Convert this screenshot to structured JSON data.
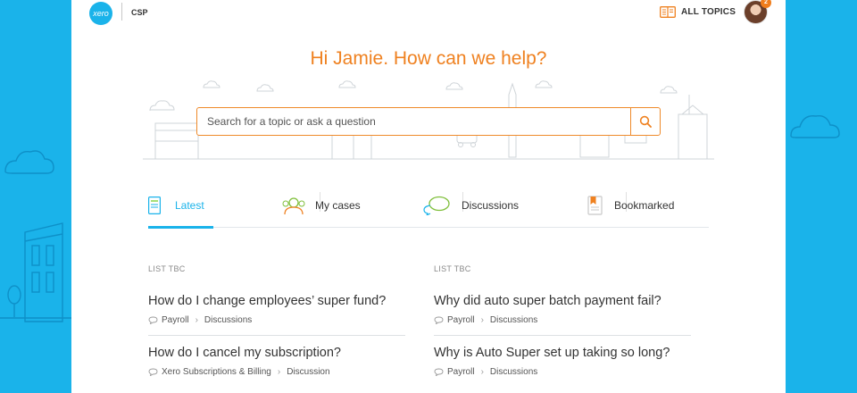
{
  "header": {
    "logo_text": "xero",
    "org_name": "CSP",
    "all_topics_label": "ALL TOPICS",
    "notification_count": "2"
  },
  "greeting": "Hi Jamie. How can we help?",
  "search": {
    "placeholder": "Search for a topic or ask a question"
  },
  "tabs": [
    {
      "label": "Latest",
      "icon": "latest-icon",
      "active": true
    },
    {
      "label": "My cases",
      "icon": "my-cases-icon",
      "active": false
    },
    {
      "label": "Discussions",
      "icon": "discussions-icon",
      "active": false
    },
    {
      "label": "Bookmarked",
      "icon": "bookmark-icon",
      "active": false
    }
  ],
  "lists": [
    {
      "heading": "LIST TBC",
      "items": [
        {
          "question": "How do I change employees’ super fund?",
          "category": "Payroll",
          "section": "Discussions"
        },
        {
          "question": "How do I cancel my subscription?",
          "category": "Xero Subscriptions & Billing",
          "section": "Discussion"
        }
      ]
    },
    {
      "heading": "LIST TBC",
      "items": [
        {
          "question": "Why did auto super batch payment fail?",
          "category": "Payroll",
          "section": "Discussions"
        },
        {
          "question": "Why is Auto Super set up taking so long?",
          "category": "Payroll",
          "section": "Discussions"
        }
      ]
    }
  ],
  "colors": {
    "brand_blue": "#1ab3ea",
    "accent_orange": "#ef8120",
    "background": "#1ab3ea"
  }
}
